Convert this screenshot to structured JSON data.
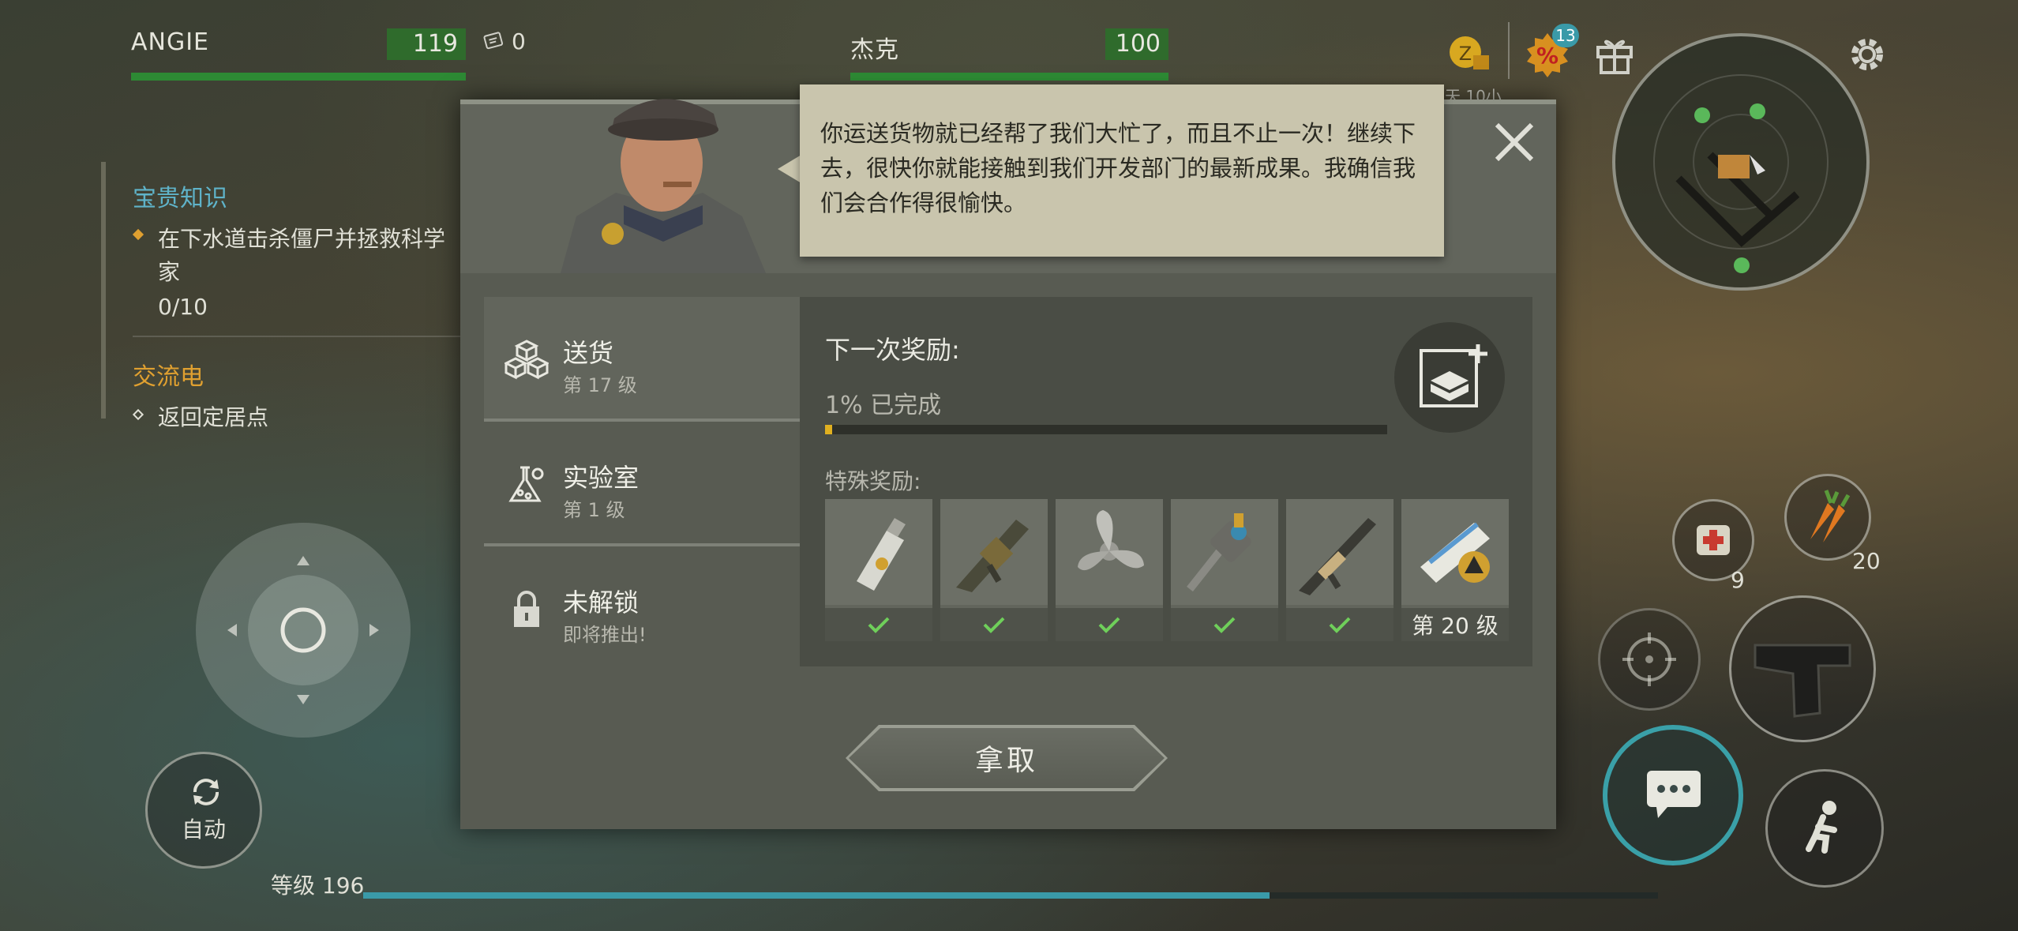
{
  "top_bar": {
    "player1": {
      "name": "ANGIE",
      "hp": "119"
    },
    "coupon_count": "0",
    "player2": {
      "name": "杰克",
      "hp": "100"
    },
    "discount_badge": "13",
    "time_text": "天 10小"
  },
  "quests": {
    "section1_title": "宝贵知识",
    "section1_task": "在下水道击杀僵尸并拯救科学家",
    "section1_progress": "0/10",
    "section2_title": "交流电",
    "section2_task": "返回定居点"
  },
  "dialog": {
    "speech": "你运送货物就已经帮了我们大忙了，而且不止一次！继续下去，很快你就能接触到我们开发部门的最新成果。我确信我们会合作得很愉快。",
    "tabs": [
      {
        "title": "送货",
        "subtitle": "第 17 级"
      },
      {
        "title": "实验室",
        "subtitle": "第 1 级"
      },
      {
        "title": "未解锁",
        "subtitle": "即将推出!"
      }
    ],
    "next_reward_label": "下一次奖励:",
    "progress_label": "1% 已完成",
    "progress_fraction": 0.01,
    "special_rewards_label": "特殊奖励:",
    "rewards": [
      {
        "icon": "keycard-icon",
        "claimed": true
      },
      {
        "icon": "grenade-launcher-icon",
        "claimed": true
      },
      {
        "icon": "propeller-icon",
        "claimed": true
      },
      {
        "icon": "drill-gun-icon",
        "claimed": true
      },
      {
        "icon": "assault-rifle-icon",
        "claimed": true
      },
      {
        "icon": "blueprint-scroll-icon",
        "claimed": false,
        "level_label": "第 20 级"
      }
    ],
    "take_button": "拿取"
  },
  "hud": {
    "medkit_count": "9",
    "carrot_count": "20",
    "auto_label": "自动",
    "level_label": "等级 196",
    "xp_fraction": 0.7
  },
  "colors": {
    "accent_teal": "#3a9aa8",
    "hp_green": "#2d8a34",
    "quest_blue": "#5fb3c9",
    "quest_orange": "#e0a030",
    "check_green": "#6fcf5a",
    "progress_yellow": "#e0b020"
  }
}
